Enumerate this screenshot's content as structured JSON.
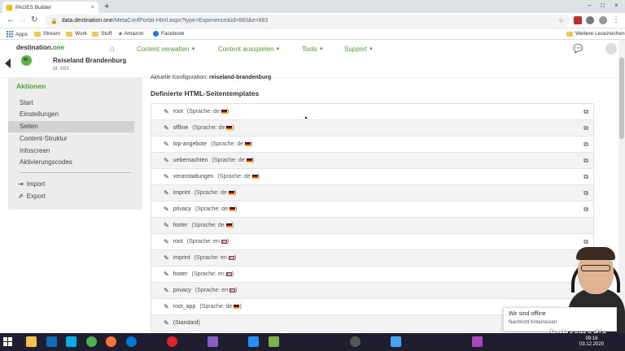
{
  "browser": {
    "tab_title": "PAGES Builder",
    "tab_close": "×",
    "new_tab": "+",
    "window_controls": [
      "–",
      "□",
      "×"
    ],
    "url_host": "data.destination.one",
    "url_path": "/MetaConfPortal-Html.aspx?type=Experience&id=683&e=683",
    "bookmarks": [
      "Apps",
      "Stream",
      "Work",
      "Stuff",
      "Amazon",
      "Facebook"
    ],
    "other_bookmarks": "Weitere Lesezeichen"
  },
  "header": {
    "brand_main": "destination.",
    "brand_accent": "one",
    "project_name": "Reiseland Brandenburg",
    "project_id": "Id: 683",
    "nav": [
      "Content verwalten",
      "Content ausspielen",
      "Tools",
      "Support"
    ]
  },
  "sidebar": {
    "title": "Aktionen",
    "items": [
      "Start",
      "Einstellungen",
      "Seiten",
      "Content-Struktur",
      "Infoscreen",
      "Aktivierungscodes"
    ],
    "active_item": "Seiten",
    "actions": [
      "Import",
      "Export"
    ]
  },
  "main": {
    "config_label": "Aktuelle Konfiguration:",
    "config_value": "reiseland-brandenburg",
    "section_title": "Definierte HTML-Seitentemplates",
    "templates": [
      {
        "name": "root",
        "lang": "(Sprache: de",
        "flag": "de",
        "ext": true
      },
      {
        "name": "offline",
        "lang": "(Sprache: de",
        "flag": "de",
        "ext": true
      },
      {
        "name": "top-angebote",
        "lang": "(Sprache: de",
        "flag": "de",
        "ext": true
      },
      {
        "name": "uebernachten",
        "lang": "(Sprache: de",
        "flag": "de",
        "ext": true
      },
      {
        "name": "veranstaltungen",
        "lang": "(Sprache: de",
        "flag": "de",
        "ext": true
      },
      {
        "name": "imprint",
        "lang": "(Sprache: de",
        "flag": "de",
        "ext": true
      },
      {
        "name": "privacy",
        "lang": "(Sprache: de",
        "flag": "de",
        "ext": true
      },
      {
        "name": "footer",
        "lang": "(Sprache: de",
        "flag": "de",
        "ext": false
      },
      {
        "name": "root",
        "lang": "(Sprache: en",
        "flag": "en",
        "ext": true
      },
      {
        "name": "imprint",
        "lang": "(Sprache: en",
        "flag": "en",
        "ext": true
      },
      {
        "name": "footer",
        "lang": "(Sprache: en",
        "flag": "en",
        "ext": false
      },
      {
        "name": "privacy",
        "lang": "(Sprache: en",
        "flag": "en",
        "ext": false
      },
      {
        "name": "root_app",
        "lang": "(Sprache: de",
        "flag": "de",
        "ext": false
      },
      {
        "name": "(Standard)",
        "lang": "",
        "flag": "",
        "ext": false
      }
    ]
  },
  "toast": {
    "title": "Wir sind offline",
    "text": "Nachricht hinterlassen"
  },
  "overlay": {
    "logo_text": "hubermedia"
  },
  "taskbar": {
    "time": "09:16",
    "date": "03.12.2020"
  },
  "colors": {
    "accent": "#4d9f2c",
    "sidebar_bg": "#ececec",
    "taskbar_bg": "#1e1e2e"
  }
}
